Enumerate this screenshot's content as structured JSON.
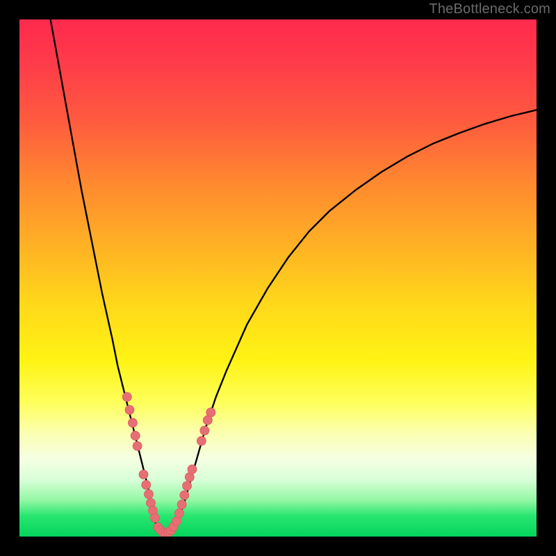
{
  "watermark": "TheBottleneck.com",
  "colors": {
    "frame": "#000000",
    "curve": "#000000",
    "dots": "#e76f74",
    "dots_stroke": "#d85a60"
  },
  "chart_data": {
    "type": "line",
    "title": "",
    "xlabel": "",
    "ylabel": "",
    "xlim": [
      0,
      100
    ],
    "ylim": [
      0,
      100
    ],
    "series": [
      {
        "name": "left-branch",
        "x": [
          6,
          8,
          10,
          12,
          14,
          16,
          18,
          19,
          20,
          21,
          22,
          23,
          24,
          25,
          25.5,
          26,
          26.5
        ],
        "y": [
          100,
          89,
          78,
          67,
          57,
          47,
          38,
          33,
          29,
          25,
          21,
          17,
          13,
          9,
          6,
          4,
          2
        ]
      },
      {
        "name": "valley-floor",
        "x": [
          26.5,
          27,
          27.5,
          28,
          28.5,
          29,
          29.5,
          30,
          30.5
        ],
        "y": [
          2,
          1.2,
          0.7,
          0.5,
          0.5,
          0.7,
          1.2,
          1.8,
          2.5
        ]
      },
      {
        "name": "right-branch",
        "x": [
          30.5,
          32,
          34,
          36,
          38,
          40,
          44,
          48,
          52,
          56,
          60,
          65,
          70,
          75,
          80,
          85,
          90,
          95,
          100
        ],
        "y": [
          2.5,
          7,
          14,
          21,
          27,
          32,
          41,
          48,
          54,
          59,
          63,
          67,
          70.5,
          73.5,
          76,
          78,
          79.8,
          81.3,
          82.5
        ]
      }
    ],
    "scatter": [
      {
        "name": "left-cluster-upper",
        "x": [
          20.8,
          21.3,
          21.9,
          22.4,
          22.8
        ],
        "y": [
          27,
          24.5,
          22,
          19.5,
          17.5
        ]
      },
      {
        "name": "left-cluster-lower",
        "x": [
          24.0,
          24.5,
          25.0,
          25.4,
          25.8,
          26.2
        ],
        "y": [
          12,
          10,
          8.2,
          6.5,
          5.0,
          3.6
        ]
      },
      {
        "name": "valley-cluster",
        "x": [
          26.8,
          27.3,
          27.8,
          28.3,
          28.8,
          29.3,
          29.8
        ],
        "y": [
          1.8,
          1.2,
          0.8,
          0.6,
          0.8,
          1.2,
          1.9
        ]
      },
      {
        "name": "right-cluster-lower",
        "x": [
          30.4,
          30.9,
          31.4,
          31.9,
          32.4,
          32.9,
          33.4
        ],
        "y": [
          3.0,
          4.5,
          6.2,
          8.0,
          9.8,
          11.5,
          13.0
        ]
      },
      {
        "name": "right-cluster-upper",
        "x": [
          35.2,
          35.8,
          36.4,
          37.0
        ],
        "y": [
          18.5,
          20.5,
          22.5,
          24.0
        ]
      }
    ]
  }
}
